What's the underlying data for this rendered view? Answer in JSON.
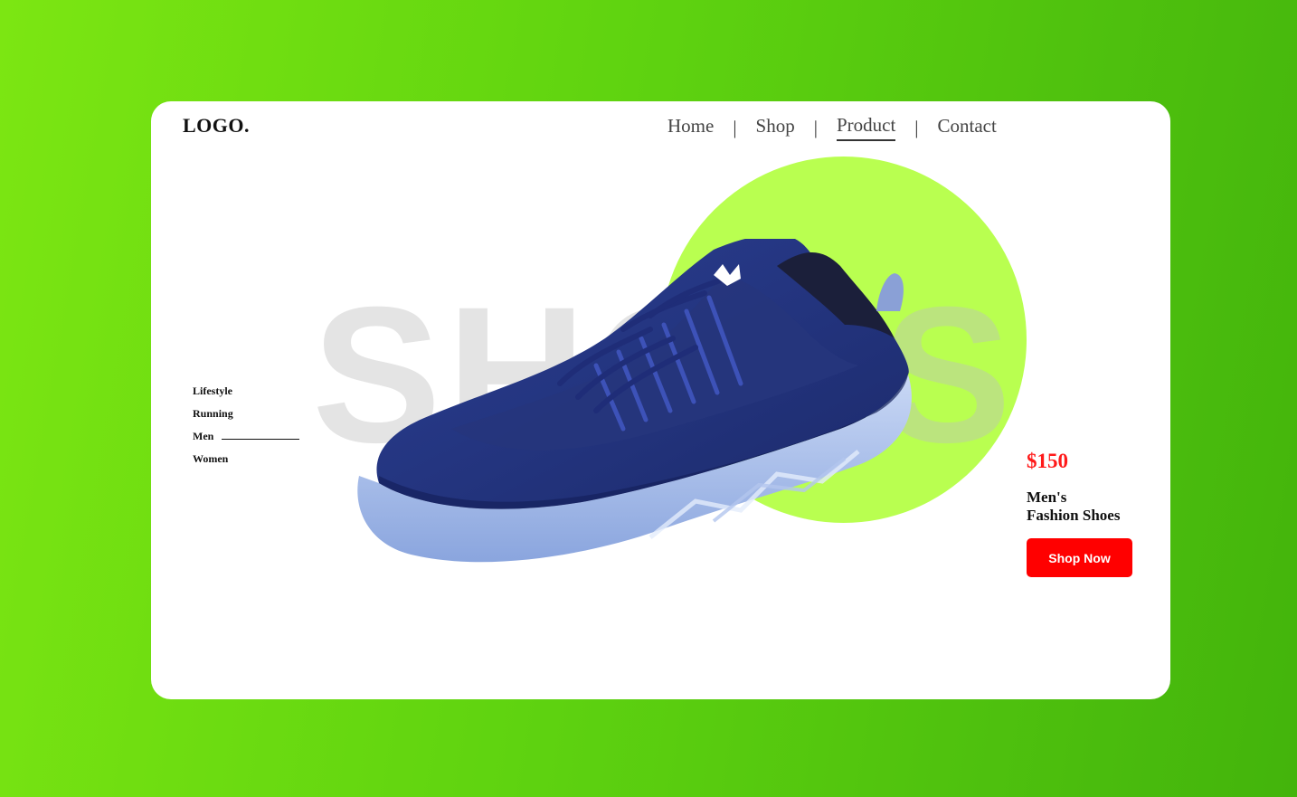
{
  "header": {
    "logo": "LOGO.",
    "nav": [
      {
        "label": "Home",
        "active": false
      },
      {
        "label": "Shop",
        "active": false
      },
      {
        "label": "Product",
        "active": true
      },
      {
        "label": "Contact",
        "active": false
      }
    ],
    "separator": "|"
  },
  "hero": {
    "background_word": "SHOES",
    "circle_color": "#b9ff50"
  },
  "categories": [
    {
      "label": "Lifestyle",
      "selected": false
    },
    {
      "label": "Running",
      "selected": false
    },
    {
      "label": "Men",
      "selected": true
    },
    {
      "label": "Women",
      "selected": false
    }
  ],
  "product": {
    "price": "$150",
    "title_line1": "Men's",
    "title_line2": "Fashion Shoes",
    "cta_label": "Shop Now",
    "cta_color": "#ff0000",
    "price_color": "#ff1a1a"
  },
  "theme": {
    "background_gradient": [
      "#7ce612",
      "#43b40c"
    ],
    "shoe_color": "#22357f",
    "sole_color": "#9fb6e8"
  }
}
